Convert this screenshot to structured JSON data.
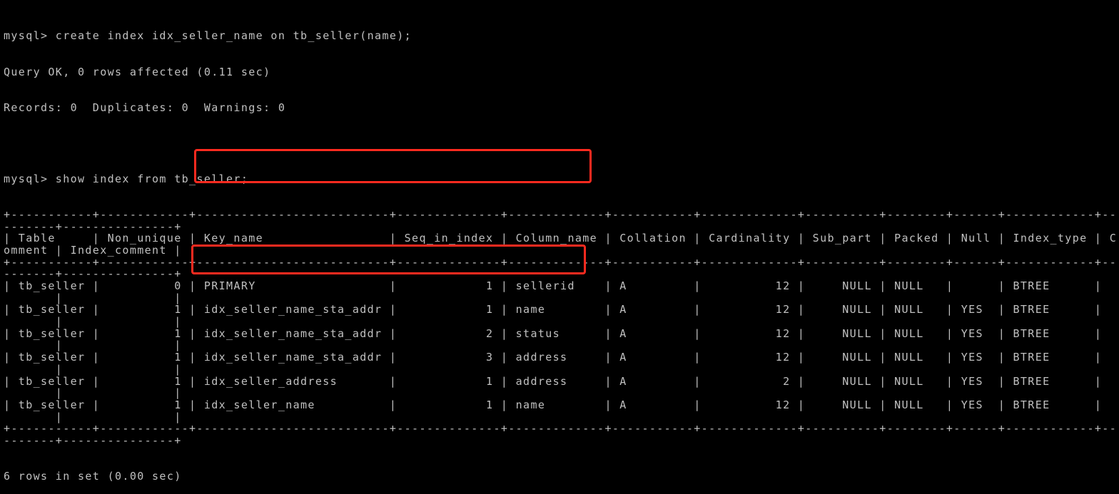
{
  "terminal": {
    "command1": "mysql> create index idx_seller_name on tb_seller(name);",
    "result1_line1": "Query OK, 0 rows affected (0.11 sec)",
    "result1_line2": "Records: 0  Duplicates: 0  Warnings: 0",
    "command2": "mysql> show index from tb_seller;",
    "footer": "6 rows in set (0.00 sec)",
    "wrap_columns": 150,
    "text_color": "#c0c0c0",
    "highlight_color": "#ff2a1f"
  },
  "index_table": {
    "columns": [
      "Table",
      "Non_unique",
      "Key_name",
      "Seq_in_index",
      "Column_name",
      "Collation",
      "Cardinality",
      "Sub_part",
      "Packed",
      "Null",
      "Index_type",
      "Comment",
      "Index_comment"
    ],
    "right_aligned": [
      1,
      3,
      6,
      7
    ],
    "rows": [
      [
        "tb_seller",
        "0",
        "PRIMARY",
        "1",
        "sellerid",
        "A",
        "12",
        "NULL",
        "NULL",
        "",
        "BTREE",
        "",
        ""
      ],
      [
        "tb_seller",
        "1",
        "idx_seller_name_sta_addr",
        "1",
        "name",
        "A",
        "12",
        "NULL",
        "NULL",
        "YES",
        "BTREE",
        "",
        ""
      ],
      [
        "tb_seller",
        "1",
        "idx_seller_name_sta_addr",
        "2",
        "status",
        "A",
        "12",
        "NULL",
        "NULL",
        "YES",
        "BTREE",
        "",
        ""
      ],
      [
        "tb_seller",
        "1",
        "idx_seller_name_sta_addr",
        "3",
        "address",
        "A",
        "12",
        "NULL",
        "NULL",
        "YES",
        "BTREE",
        "",
        ""
      ],
      [
        "tb_seller",
        "1",
        "idx_seller_address",
        "1",
        "address",
        "A",
        "2",
        "NULL",
        "NULL",
        "YES",
        "BTREE",
        "",
        ""
      ],
      [
        "tb_seller",
        "1",
        "idx_seller_name",
        "1",
        "name",
        "A",
        "12",
        "NULL",
        "NULL",
        "YES",
        "BTREE",
        "",
        ""
      ]
    ],
    "highlighted_rows": [
      1,
      5
    ]
  }
}
